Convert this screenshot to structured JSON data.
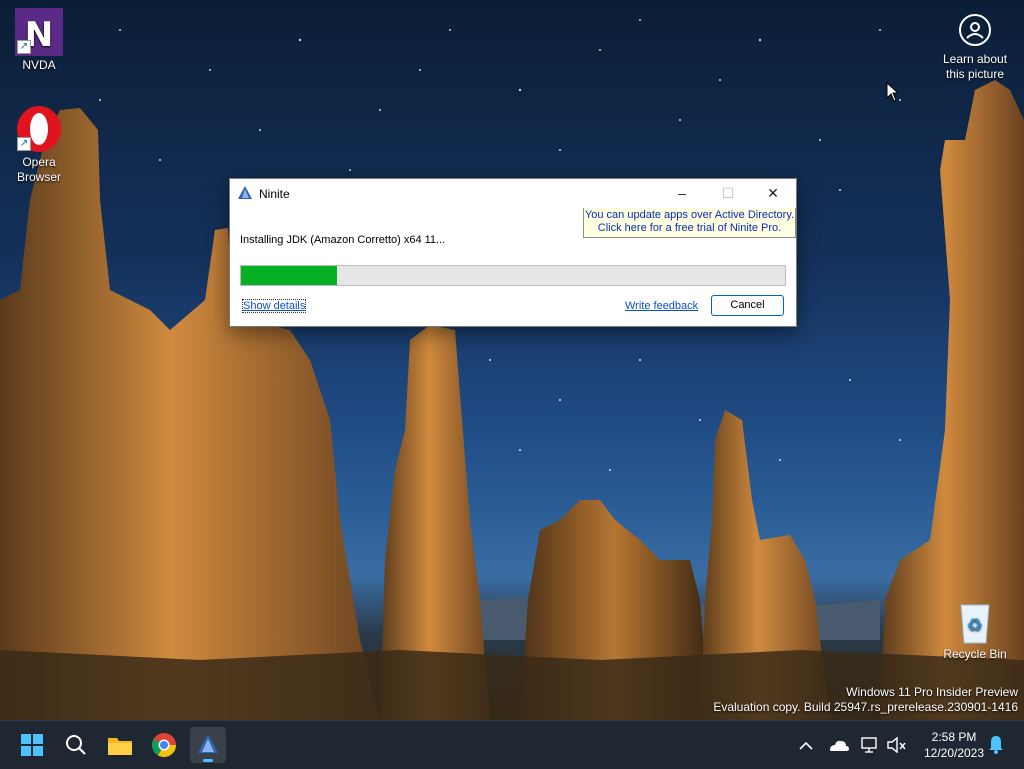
{
  "desktop": {
    "icons": [
      {
        "label": "NVDA"
      },
      {
        "label": "Opera Browser"
      },
      {
        "label": "Recycle Bin"
      }
    ],
    "learn_about": "Learn about this picture",
    "watermark": {
      "line1": "Windows 11 Pro Insider Preview",
      "line2": "Evaluation copy. Build 25947.rs_prerelease.230901-1416"
    }
  },
  "window": {
    "title": "Ninite",
    "promo_line1": "You can update apps over Active Directory.",
    "promo_line2": "Click here for a free trial of Ninite Pro.",
    "status": "Installing JDK (Amazon Corretto) x64 11...",
    "progress": 0.177,
    "show_details": "Show details",
    "write_feedback": "Write feedback",
    "cancel": "Cancel",
    "buttons": {
      "minimize": "–",
      "maximize": "☐",
      "close": "✕"
    }
  },
  "taskbar": {
    "apps": [
      "start-icon",
      "search-icon",
      "file-explorer-icon",
      "chrome-icon",
      "ninite-icon"
    ],
    "time": "2:58 PM",
    "date": "12/20/2023"
  },
  "colors": {
    "accent": "#0067c0",
    "progress": "#06b025",
    "link": "#0b4fd0",
    "promo_bg": "#ffffe1"
  }
}
